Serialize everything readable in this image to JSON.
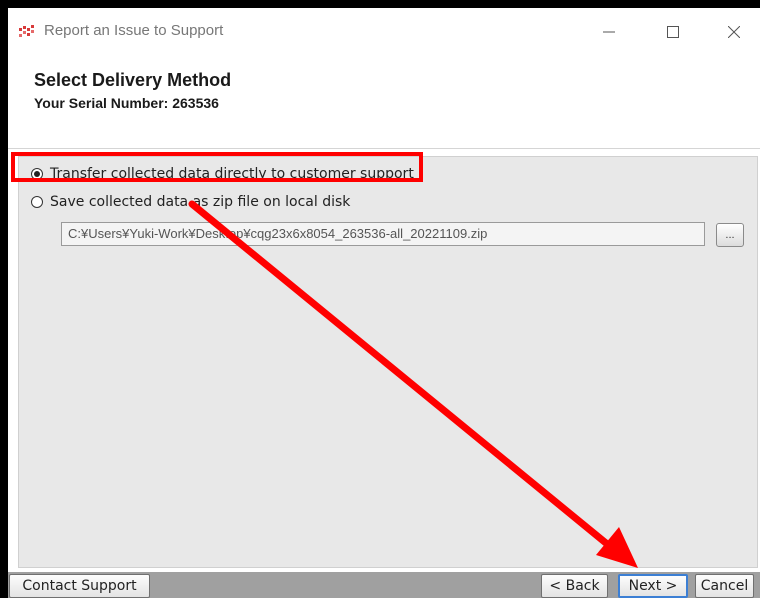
{
  "window": {
    "title": "Report an Issue to Support"
  },
  "header": {
    "heading": "Select Delivery Method",
    "serial_label": "Your Serial Number: 263536"
  },
  "delivery": {
    "options": [
      {
        "label": "Transfer collected data directly to customer support",
        "selected": true
      },
      {
        "label": "Save collected data as zip file on local disk",
        "selected": false
      }
    ],
    "file_path": "C:¥Users¥Yuki-Work¥Desktop¥cqg23x6x8054_263536-all_20221109.zip",
    "browse_label": "..."
  },
  "footer": {
    "contact_label": "Contact Support",
    "back_label": "< Back",
    "next_label": "Next >",
    "cancel_label": "Cancel"
  },
  "colors": {
    "annotation": "#ff0000",
    "panel_bg": "#e8e8e8",
    "default_button_border": "#3c7fd4",
    "footer_bg": "#a0a0a0"
  },
  "icons": {
    "app": "app-logo-icon",
    "minimize": "minimize-icon",
    "maximize": "maximize-icon",
    "close": "close-icon"
  }
}
